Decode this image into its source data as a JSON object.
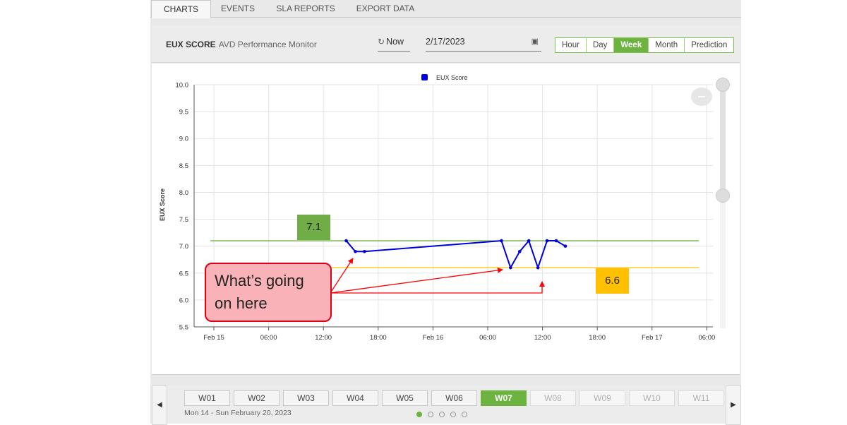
{
  "tabs": [
    {
      "label": "CHARTS",
      "active": true
    },
    {
      "label": "EVENTS",
      "active": false
    },
    {
      "label": "SLA REPORTS",
      "active": false
    },
    {
      "label": "EXPORT DATA",
      "active": false
    }
  ],
  "header": {
    "title": "EUX SCORE",
    "subtitle": "AVD Performance Monitor",
    "now_label": "Now",
    "date_value": "2/17/2023",
    "ranges": [
      {
        "label": "Hour",
        "active": false
      },
      {
        "label": "Day",
        "active": false
      },
      {
        "label": "Week",
        "active": true
      },
      {
        "label": "Month",
        "active": false
      },
      {
        "label": "Prediction",
        "active": false
      }
    ]
  },
  "chart_data": {
    "type": "line",
    "legend": "EUX Score",
    "legend_position": "top-center",
    "ylabel": "EUX Score",
    "ylim": [
      5.5,
      10.0
    ],
    "yticks": [
      "10.0",
      "9.5",
      "9.0",
      "8.5",
      "8.0",
      "7.5",
      "7.0",
      "6.5",
      "6.0",
      "5.5"
    ],
    "xticks": [
      "Feb 15",
      "06:00",
      "12:00",
      "18:00",
      "Feb 16",
      "06:00",
      "12:00",
      "18:00",
      "Feb 17",
      "06:00"
    ],
    "x_unit": "hours from Feb 15 00:00",
    "series": [
      {
        "name": "EUX Score",
        "color": "#0000dd",
        "points": [
          {
            "x": 14.5,
            "y": 7.1
          },
          {
            "x": 15.5,
            "y": 6.9
          },
          {
            "x": 16.5,
            "y": 6.9
          },
          {
            "x": 31.5,
            "y": 7.1
          },
          {
            "x": 32.5,
            "y": 6.6
          },
          {
            "x": 33.5,
            "y": 6.9
          },
          {
            "x": 34.5,
            "y": 7.1
          },
          {
            "x": 35.5,
            "y": 6.6
          },
          {
            "x": 36.5,
            "y": 7.1
          },
          {
            "x": 37.5,
            "y": 7.1
          },
          {
            "x": 38.5,
            "y": 7.0
          }
        ]
      }
    ],
    "thresholds": [
      {
        "value": 7.1,
        "label": "7.1",
        "color": "#70ad47",
        "label_bg": "#70ad47"
      },
      {
        "value": 6.6,
        "label": "6.6",
        "color": "#ffc000",
        "label_bg": "#ffc000"
      }
    ],
    "grid": true
  },
  "annotation": {
    "text_line1": "What’s going",
    "text_line2": "on here"
  },
  "weeks": [
    {
      "label": "W01",
      "state": "normal"
    },
    {
      "label": "W02",
      "state": "normal"
    },
    {
      "label": "W03",
      "state": "normal"
    },
    {
      "label": "W04",
      "state": "normal"
    },
    {
      "label": "W05",
      "state": "normal"
    },
    {
      "label": "W06",
      "state": "normal"
    },
    {
      "label": "W07",
      "state": "active"
    },
    {
      "label": "W08",
      "state": "disabled"
    },
    {
      "label": "W09",
      "state": "disabled"
    },
    {
      "label": "W10",
      "state": "disabled"
    },
    {
      "label": "W11",
      "state": "disabled"
    }
  ],
  "week_range": "Mon 14 - Sun February 20, 2023",
  "pages": 5,
  "active_page": 0,
  "colors": {
    "accent": "#6cb33f",
    "series": "#0000dd",
    "callout_border": "#e0001a",
    "callout_fill": "#f9b3b8"
  }
}
